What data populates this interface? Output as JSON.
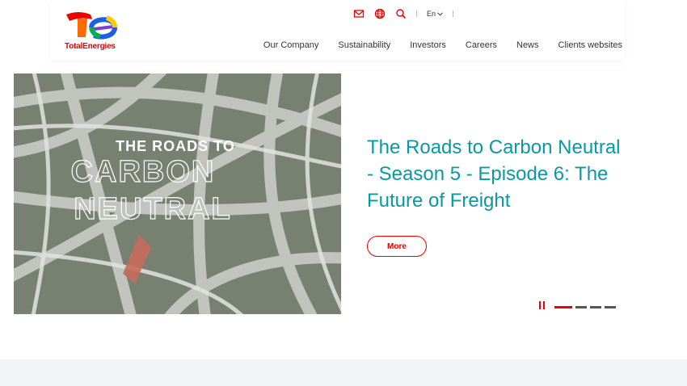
{
  "brand": {
    "name": "TotalEnergies",
    "color": "#ed0000"
  },
  "utilities": {
    "icons": [
      "mail-icon",
      "globe-icon",
      "search-icon"
    ],
    "language": "En"
  },
  "nav": {
    "items": [
      {
        "label": "Our Company"
      },
      {
        "label": "Sustainability"
      },
      {
        "label": "Investors"
      },
      {
        "label": "Careers"
      },
      {
        "label": "News"
      },
      {
        "label": "Clients websites"
      }
    ]
  },
  "hero": {
    "image_text": {
      "line1": "THE ROADS TO",
      "line2": "CARBON",
      "line3": "NEUTRAL"
    },
    "title": "The Roads to Carbon Neutral - Season 5 - Episode 6: The Future of Freight",
    "more_label": "More",
    "title_color": "#0899a4"
  },
  "carousel": {
    "slides": 4,
    "active": 1
  }
}
